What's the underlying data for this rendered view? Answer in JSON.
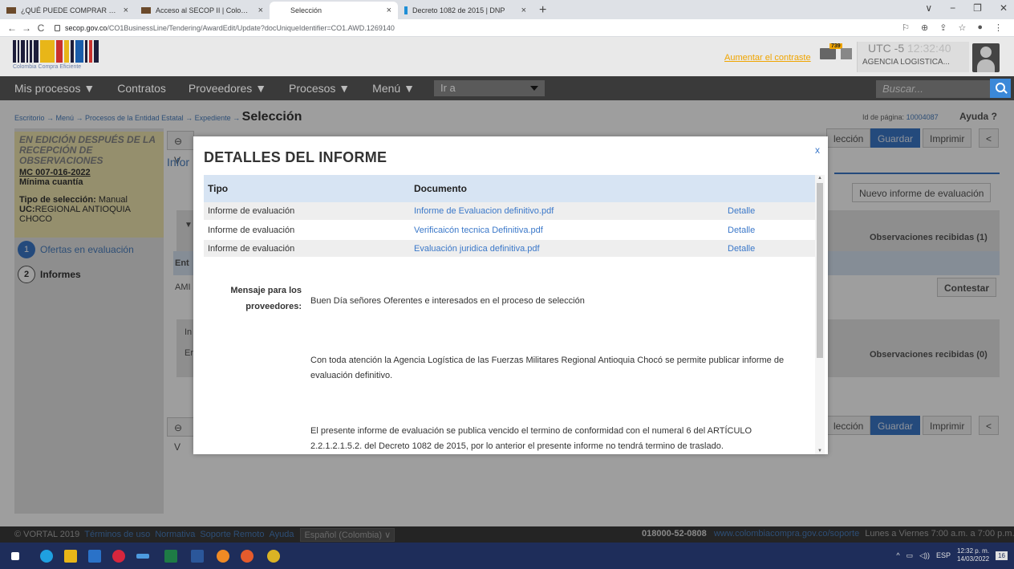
{
  "browser": {
    "tabs": [
      {
        "label": "¿QUÉ PUEDE COMPRAR POR ME",
        "active": false
      },
      {
        "label": "Acceso al SECOP II | Colombia C",
        "active": false
      },
      {
        "label": "Selección",
        "active": true
      },
      {
        "label": "Decreto 1082 de 2015 | DNP",
        "active": false
      }
    ],
    "url_host": "secop.gov.co",
    "url_path": "/CO1BusinessLine/Tendering/AwardEdit/Update?docUniqueIdentifier=CO1.AWD.1269140"
  },
  "header": {
    "logo_text": "Colombia Compra Eficiente",
    "aumentar_link": "Aumentar el contraste",
    "mail_badge": "739",
    "utc": "UTC -5",
    "time": "12:32:40",
    "agency": "AGENCIA LOGISTICA..."
  },
  "navbar": {
    "items": [
      "Mis procesos ▼",
      "Contratos",
      "Proveedores ▼",
      "Procesos ▼",
      "Menú ▼"
    ],
    "ira": "Ir a",
    "search_placeholder": "Buscar..."
  },
  "breadcrumb": {
    "path": "Escritorio → Menú → Procesos de la Entidad Estatal → Expediente →",
    "current": "Selección"
  },
  "page_id": {
    "label": "Id de página:",
    "value": "10004087",
    "help": "Ayuda ?"
  },
  "sidebar": {
    "status": "EN EDICIÓN DESPUÉS DE LA RECEPCIÓN DE OBSERVACIONES",
    "reference": "MC 007-016-2022",
    "modality": "Mínima cuantía",
    "selection_type_label": "Tipo de selección:",
    "selection_type": "Manual",
    "uc_label": "UC:",
    "uc": "REGIONAL ANTIOQUIA CHOCO",
    "steps": [
      {
        "num": "1",
        "label": "Ofertas en evaluación"
      },
      {
        "num": "2",
        "label": "Informes"
      }
    ]
  },
  "background": {
    "volver": "V",
    "infor": "Infor",
    "seleccion": "lección",
    "guardar": "Guardar",
    "imprimir": "Imprimir",
    "back": "<",
    "nuevo_informe": "Nuevo informe de evaluación",
    "obs1": "Observaciones recibidas (1)",
    "obs0": "Observaciones recibidas (0)",
    "contestar": "Contestar",
    "ent": "Ent",
    "ami": "AMI",
    "inf": "In",
    "en": "Er"
  },
  "modal": {
    "title": "DETALLES DEL INFORME",
    "close": "x",
    "columns": [
      "Tipo",
      "Documento"
    ],
    "rows": [
      {
        "tipo": "Informe de evaluación",
        "documento": "Informe de Evaluacion definitivo.pdf",
        "accion": "Detalle"
      },
      {
        "tipo": "Informe de evaluación",
        "documento": "Verificaicón tecnica Definitiva.pdf",
        "accion": "Detalle"
      },
      {
        "tipo": "Informe de evaluación",
        "documento": "Evaluación juridica definitiva.pdf",
        "accion": "Detalle"
      }
    ],
    "message_label": "Mensaje para los proveedores:",
    "message_paragraphs": [
      "Buen Día señores Oferentes e interesados en el proceso de selección",
      "Con toda atención la Agencia Logística de las Fuerzas Militares Regional Antioquia Chocó se permite publicar informe de evaluación definitivo.",
      "El presente informe de evaluación se publica vencido el termino de conformidad con el numeral 6 del ARTÍCULO 2.2.1.2.1.5.2. del Decreto 1082 de 2015, por lo anterior el presente informe no tendrá termino de traslado."
    ]
  },
  "footer": {
    "copyright": "© VORTAL 2019",
    "links": [
      "Términos de uso",
      "Normativa",
      "Soporte Remoto",
      "Ayuda"
    ],
    "language": "Español (Colombia) ∨",
    "phone": "018000-52-0808",
    "support_url": "www.colombiacompra.gov.co/soporte",
    "hours": "Lunes a Viernes 7:00 a.m. a 7:00 p.m."
  },
  "taskbar": {
    "lang": "ESP",
    "time": "12:32 p. m.",
    "date": "14/03/2022",
    "notifications": "16"
  },
  "colors": {
    "accent": "#3b78c9",
    "navbar": "#3a3a3a",
    "status_bg": "#f0e7b0",
    "table_header": "#d7e4f3",
    "taskbar": "#1e2d5a"
  }
}
